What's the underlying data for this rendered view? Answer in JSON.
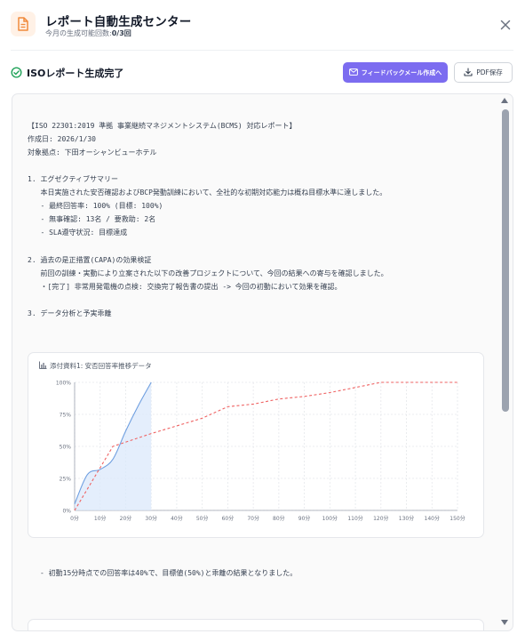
{
  "header": {
    "title": "レポート自動生成センター",
    "subtitle_prefix": "今月の生成可能回数:",
    "subtitle_count": "0/3回"
  },
  "status": {
    "text": "ISOレポート生成完了",
    "feedback_button": "フィードバックメール作成へ",
    "pdf_button": "PDF保存"
  },
  "report": {
    "lines": [
      "【ISO 22301:2019 準拠 事業継続マネジメントシステム(BCMS) 対応レポート】",
      "作成日: 2026/1/30",
      "対象拠点: 下田オーシャンビューホテル",
      "",
      "1. エグゼクティブサマリー",
      "   本日実施された安否確認およびBCP発動訓練において、全社的な初期対応能力は概ね目標水準に達しました。",
      "   - 最終回答率: 100% (目標: 100%)",
      "   - 無事確認: 13名 / 要救助: 2名",
      "   - SLA遵守状況: 目標達成",
      "",
      "2. 過去の是正措置(CAPA)の効果検証",
      "   前回の訓練・実動により立案された以下の改善プロジェクトについて、今回の結果への寄与を確認しました。",
      "   ・[完了] 非常用発電機の点検: 交換完了報告書の提出 -> 今回の初動において効果を確認。",
      "",
      "3. データ分析と予実乖離"
    ],
    "note": "- 初動15分時点での回答率は40%で、目標値(50%)と乖離の結果となりました。"
  },
  "chart_card": {
    "title": "添付資料1: 安否回答率推移データ"
  },
  "chart_data": {
    "type": "line",
    "title": "添付資料1: 安否回答率推移データ",
    "x_ticks": [
      "0分",
      "10分",
      "20分",
      "30分",
      "40分",
      "50分",
      "60分",
      "70分",
      "80分",
      "90分",
      "100分",
      "110分",
      "120分",
      "130分",
      "140分",
      "150分"
    ],
    "y_ticks": [
      "0%",
      "25%",
      "50%",
      "75%",
      "100%"
    ],
    "ylim": [
      0,
      100
    ],
    "xlim": [
      0,
      150
    ],
    "grid": true,
    "series": [
      {
        "style": "solid-area",
        "color": "#6f9fe0",
        "x": [
          0,
          5,
          10,
          15,
          20,
          25,
          30
        ],
        "y": [
          5,
          28,
          32,
          40,
          62,
          82,
          100
        ]
      },
      {
        "style": "dashed",
        "color": "#ef6262",
        "x": [
          0,
          15,
          30,
          50,
          60,
          70,
          80,
          90,
          100,
          110,
          120,
          130,
          140,
          150
        ],
        "y": [
          0,
          50,
          60,
          72,
          81,
          83,
          87,
          89,
          92,
          96,
          100,
          100,
          100,
          100
        ]
      }
    ]
  }
}
